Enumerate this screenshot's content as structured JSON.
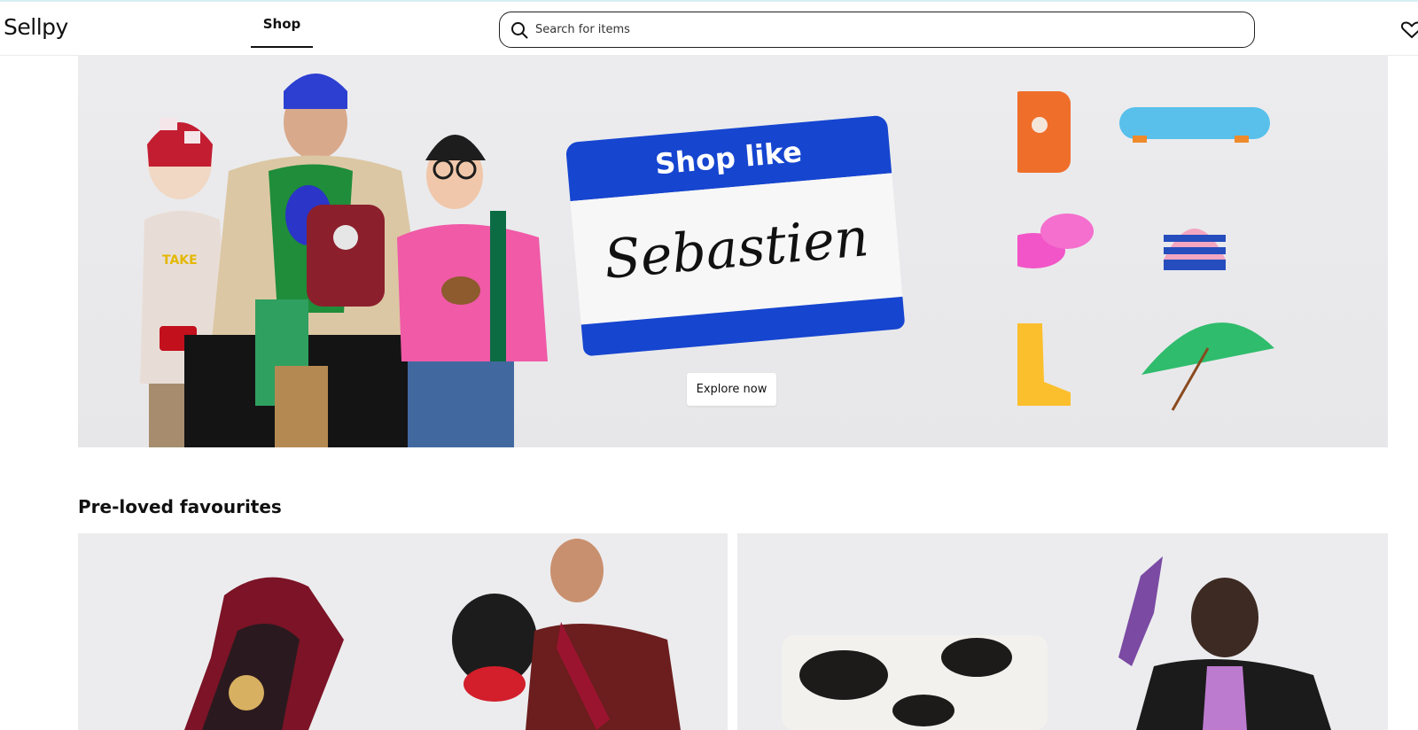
{
  "header": {
    "logo": "Sellpy",
    "tab_shop": "Shop",
    "search_placeholder": "Search for items"
  },
  "hero": {
    "sticker_top": "Shop like",
    "sticker_name": "Sebastien",
    "cta": "Explore now"
  },
  "section": {
    "title": "Pre-loved favourites"
  },
  "icons": {
    "search": "search-icon",
    "favorites": "heart-icon"
  },
  "colors": {
    "sticker_blue": "#1645cf",
    "hero_bg": "#e9e9ec"
  }
}
